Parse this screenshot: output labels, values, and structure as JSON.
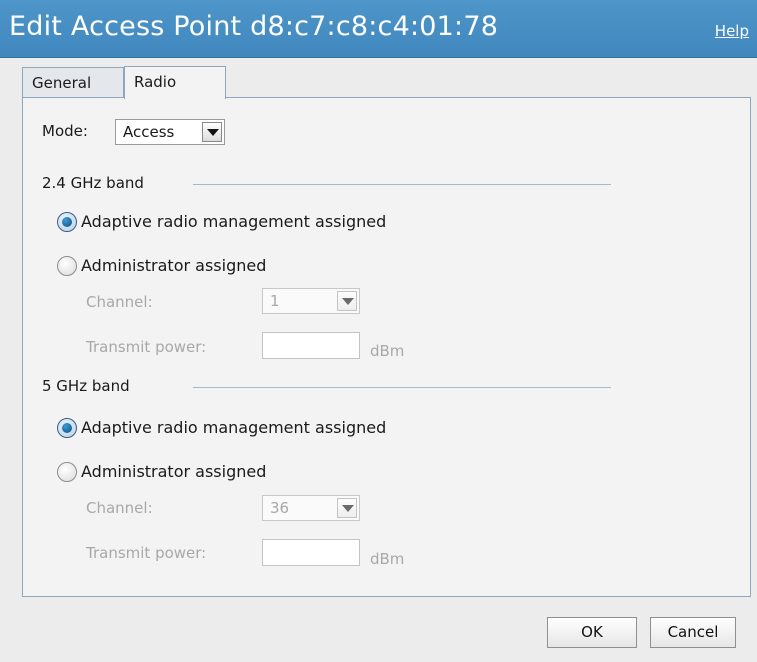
{
  "window": {
    "title": "Edit Access Point d8:c7:c8:c4:01:78",
    "help_label": "Help"
  },
  "tabs": [
    {
      "label": "General",
      "active": false
    },
    {
      "label": "Radio",
      "active": true
    }
  ],
  "mode": {
    "label": "Mode:",
    "value": "Access"
  },
  "bands": [
    {
      "label": "2.4 GHz band",
      "options": [
        {
          "label": "Adaptive radio management assigned",
          "checked": true
        },
        {
          "label": "Administrator assigned",
          "checked": false
        }
      ],
      "channel_label": "Channel:",
      "channel_value": "1",
      "power_label": "Transmit power:",
      "power_value": "",
      "power_unit": "dBm"
    },
    {
      "label": "5 GHz band",
      "options": [
        {
          "label": "Adaptive radio management assigned",
          "checked": true
        },
        {
          "label": "Administrator assigned",
          "checked": false
        }
      ],
      "channel_label": "Channel:",
      "channel_value": "36",
      "power_label": "Transmit power:",
      "power_value": "",
      "power_unit": "dBm"
    }
  ],
  "buttons": {
    "ok_label": "OK",
    "cancel_label": "Cancel"
  },
  "colors": {
    "titlebar": "#4590c4",
    "panel_border": "#8fa7bd",
    "radio_selected": "#0c4f86"
  }
}
